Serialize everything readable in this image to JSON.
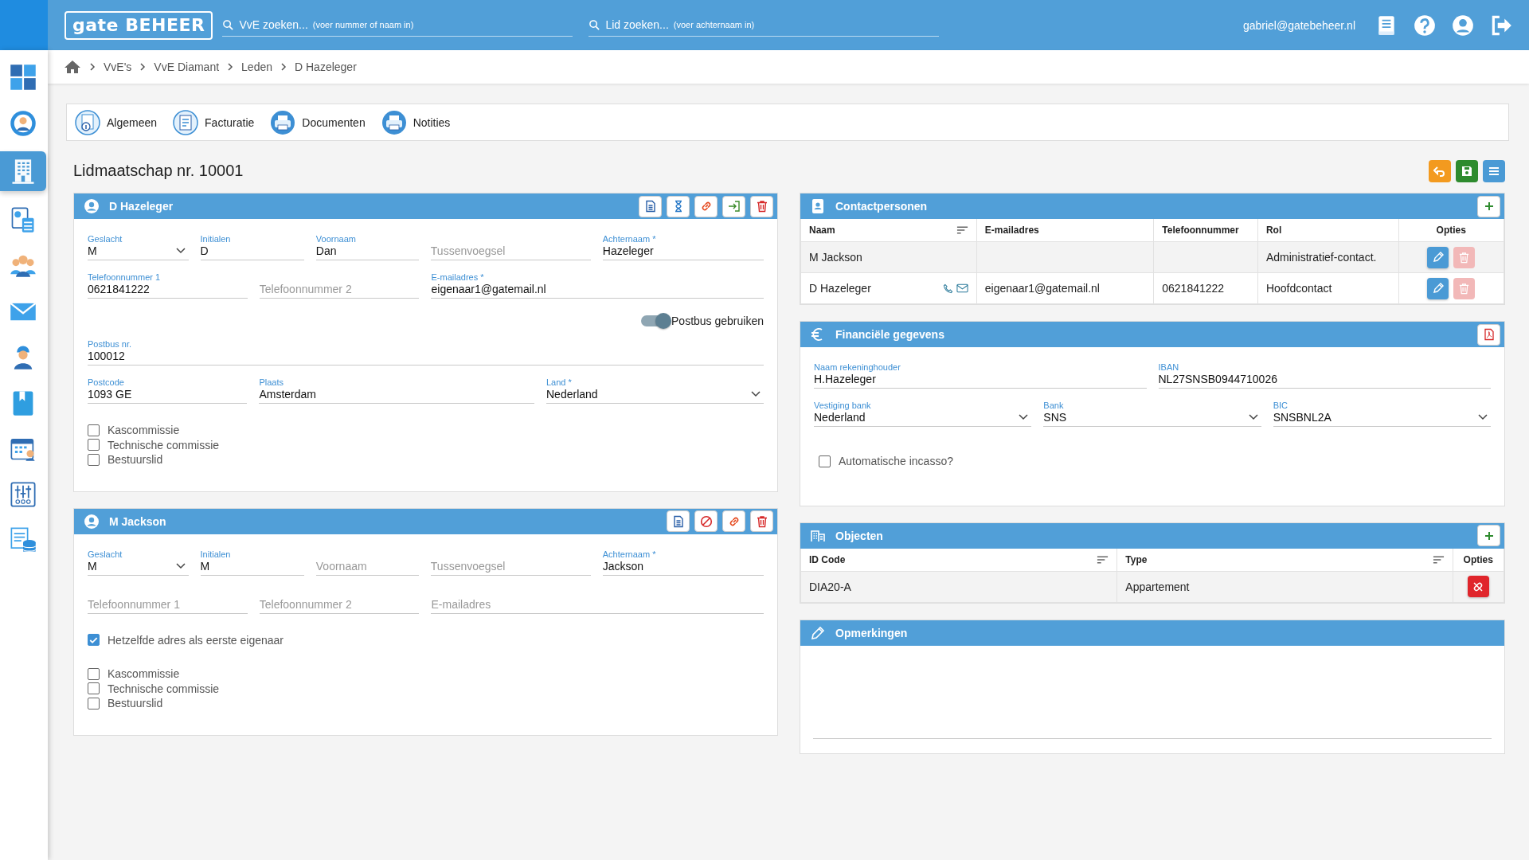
{
  "header": {
    "logo": "gate BEHEER",
    "searches": [
      {
        "placeholder": "VvE zoeken...",
        "hint": "(voer nummer of naam in)"
      },
      {
        "placeholder": "Lid zoeken...",
        "hint": "(voer achternaam in)"
      }
    ],
    "user": "gabriel@gatebeheer.nl",
    "actions": [
      {
        "kind": "manual"
      },
      {
        "kind": "help"
      },
      {
        "kind": "account"
      },
      {
        "kind": "logout"
      }
    ]
  },
  "sidebar": {
    "items": [
      {
        "kind": "dashboard",
        "selected": false
      },
      {
        "kind": "profile",
        "selected": false
      },
      {
        "kind": "building",
        "selected": true
      },
      {
        "kind": "calculator",
        "selected": false
      },
      {
        "kind": "people",
        "selected": false
      },
      {
        "kind": "mail",
        "selected": false
      },
      {
        "kind": "worker",
        "selected": false
      },
      {
        "kind": "book",
        "selected": false
      },
      {
        "kind": "calendar",
        "selected": false
      },
      {
        "kind": "sliders",
        "selected": false
      },
      {
        "kind": "database",
        "selected": false
      }
    ]
  },
  "breadcrumb": [
    "VvE's",
    "VvE Diamant",
    "Leden",
    "D Hazeleger"
  ],
  "tabs": [
    {
      "label": "Algemeen",
      "kind": "info"
    },
    {
      "label": "Facturatie",
      "kind": "invoice"
    },
    {
      "label": "Documenten",
      "kind": "printer"
    },
    {
      "label": "Notities",
      "kind": "printer"
    }
  ],
  "title": "Lidmaatschap nr. 10001",
  "page_actions": [
    {
      "kind": "undo"
    },
    {
      "kind": "save"
    },
    {
      "kind": "menu"
    }
  ],
  "members": [
    {
      "name": "D Hazeleger",
      "actions": [
        {
          "kind": "document"
        },
        {
          "kind": "hourglass"
        },
        {
          "kind": "link"
        },
        {
          "kind": "login"
        },
        {
          "kind": "trash"
        }
      ],
      "blocks": [
        {
          "kind": "fields",
          "fields": [
            {
              "label": "Geslacht",
              "value": "M",
              "kind": "select"
            },
            {
              "label": "Initialen",
              "value": "D",
              "kind": "text"
            },
            {
              "label": "Voornaam",
              "value": "Dan",
              "kind": "text"
            },
            {
              "placeholder": "Tussenvoegsel",
              "kind": "text"
            },
            {
              "label": "Achternaam *",
              "value": "Hazeleger",
              "kind": "text"
            }
          ]
        },
        {
          "kind": "fields",
          "fields": [
            {
              "label": "Telefoonnummer 1",
              "value": "0621841222",
              "kind": "text"
            },
            {
              "placeholder": "Telefoonnummer 2",
              "kind": "text"
            },
            {
              "label": "E-mailadres *",
              "value": "eigenaar1@gatemail.nl",
              "kind": "text"
            }
          ]
        },
        {
          "kind": "toggle",
          "label": "Postbus gebruiken",
          "on": true
        },
        {
          "kind": "fields",
          "fields": [
            {
              "label": "Postbus nr.",
              "value": "100012",
              "kind": "text"
            }
          ]
        },
        {
          "kind": "fields",
          "fields": [
            {
              "label": "Postcode",
              "value": "1093 GE",
              "kind": "text"
            },
            {
              "label": "Plaats",
              "value": "Amsterdam",
              "kind": "text"
            },
            {
              "label": "Land *",
              "value": "Nederland",
              "kind": "select"
            }
          ]
        },
        {
          "kind": "checkboxes",
          "items": [
            {
              "label": "Kascommissie",
              "checked": false
            },
            {
              "label": "Technische commissie",
              "checked": false
            },
            {
              "label": "Bestuurslid",
              "checked": false
            }
          ]
        }
      ]
    },
    {
      "name": "M Jackson",
      "actions": [
        {
          "kind": "document"
        },
        {
          "kind": "block"
        },
        {
          "kind": "link"
        },
        {
          "kind": "trash"
        }
      ],
      "blocks": [
        {
          "kind": "fields",
          "fields": [
            {
              "label": "Geslacht",
              "value": "M",
              "kind": "select"
            },
            {
              "label": "Initialen",
              "value": "M",
              "kind": "text"
            },
            {
              "placeholder": "Voornaam",
              "kind": "text"
            },
            {
              "placeholder": "Tussenvoegsel",
              "kind": "text"
            },
            {
              "label": "Achternaam *",
              "value": "Jackson",
              "kind": "text"
            }
          ]
        },
        {
          "kind": "fields",
          "fields": [
            {
              "placeholder": "Telefoonnummer 1",
              "kind": "text"
            },
            {
              "placeholder": "Telefoonnummer 2",
              "kind": "text"
            },
            {
              "placeholder": "E-mailadres",
              "kind": "text"
            }
          ]
        },
        {
          "kind": "checkboxes",
          "items": [
            {
              "label": "Hetzelfde adres als eerste eigenaar",
              "checked": true
            }
          ]
        },
        {
          "kind": "checkboxes",
          "items": [
            {
              "label": "Kascommissie",
              "checked": false
            },
            {
              "label": "Technische commissie",
              "checked": false
            },
            {
              "label": "Bestuurslid",
              "checked": false
            }
          ]
        }
      ]
    }
  ],
  "contacts": {
    "title": "Contactpersonen",
    "columns": [
      {
        "label": "Naam",
        "sortable": true
      },
      {
        "label": "E-mailadres",
        "sortable": false
      },
      {
        "label": "Telefoonnummer",
        "sortable": false
      },
      {
        "label": "Rol",
        "sortable": false
      },
      {
        "label": "Opties",
        "sortable": false
      }
    ],
    "rows": [
      {
        "name": "M Jackson",
        "role": "Administratief-contact.",
        "contact_icons": false,
        "delete_disabled": true
      },
      {
        "name": "D Hazeleger",
        "email": "eigenaar1@gatemail.nl",
        "phone": "0621841222",
        "role": "Hoofdcontact",
        "contact_icons": true,
        "delete_disabled": true
      }
    ]
  },
  "financial": {
    "title": "Financiële gegevens",
    "rows": [
      [
        {
          "label": "Naam rekeninghouder",
          "value": "H.Hazeleger",
          "kind": "text"
        },
        {
          "label": "IBAN",
          "value": "NL27SNSB0944710026",
          "kind": "text"
        }
      ],
      [
        {
          "label": "Vestiging bank",
          "value": "Nederland",
          "kind": "select"
        },
        {
          "label": "Bank",
          "value": "SNS",
          "kind": "select"
        },
        {
          "label": "BIC",
          "value": "SNSBNL2A",
          "kind": "select"
        }
      ]
    ],
    "checkbox": {
      "label": "Automatische incasso?",
      "checked": false
    }
  },
  "objects": {
    "title": "Objecten",
    "columns": [
      {
        "label": "ID Code",
        "sortable": true
      },
      {
        "label": "Type",
        "sortable": true
      },
      {
        "label": "Opties",
        "sortable": false
      }
    ],
    "rows": [
      {
        "id_code": "DIA20-A",
        "type": "Appartement"
      }
    ]
  },
  "remarks": {
    "title": "Opmerkingen"
  }
}
